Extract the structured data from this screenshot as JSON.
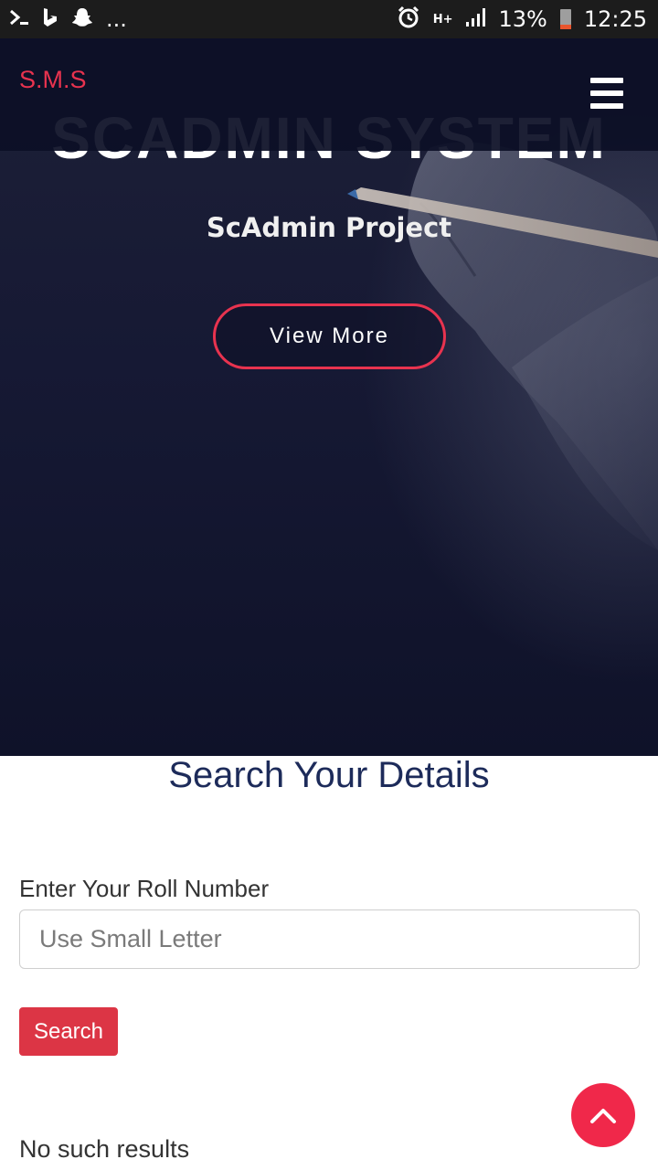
{
  "status_bar": {
    "battery_percent": "13%",
    "time": "12:25",
    "more_indicator": "...",
    "network_type": "H+",
    "left_icons": [
      "terminal-icon",
      "bing-icon",
      "snapchat-icon"
    ],
    "right_icons": [
      "alarm-icon",
      "signal-icon",
      "battery-icon"
    ]
  },
  "navbar": {
    "brand": "S.M.S",
    "brand_color": "#e8334f",
    "menu_icon": "hamburger-menu-icon"
  },
  "hero": {
    "title": "SCADMIN SYSTEM",
    "subtitle": "ScAdmin Project",
    "button_label": "View More",
    "accent_color": "#e8334f"
  },
  "search": {
    "heading": "Search Your Details",
    "field_label": "Enter Your Roll Number",
    "placeholder": "Use Small Letter",
    "button_label": "Search",
    "button_color": "#dc3545",
    "result_text": "No such results"
  },
  "back_to_top": {
    "icon": "chevron-up-icon",
    "color": "#f0284a"
  }
}
